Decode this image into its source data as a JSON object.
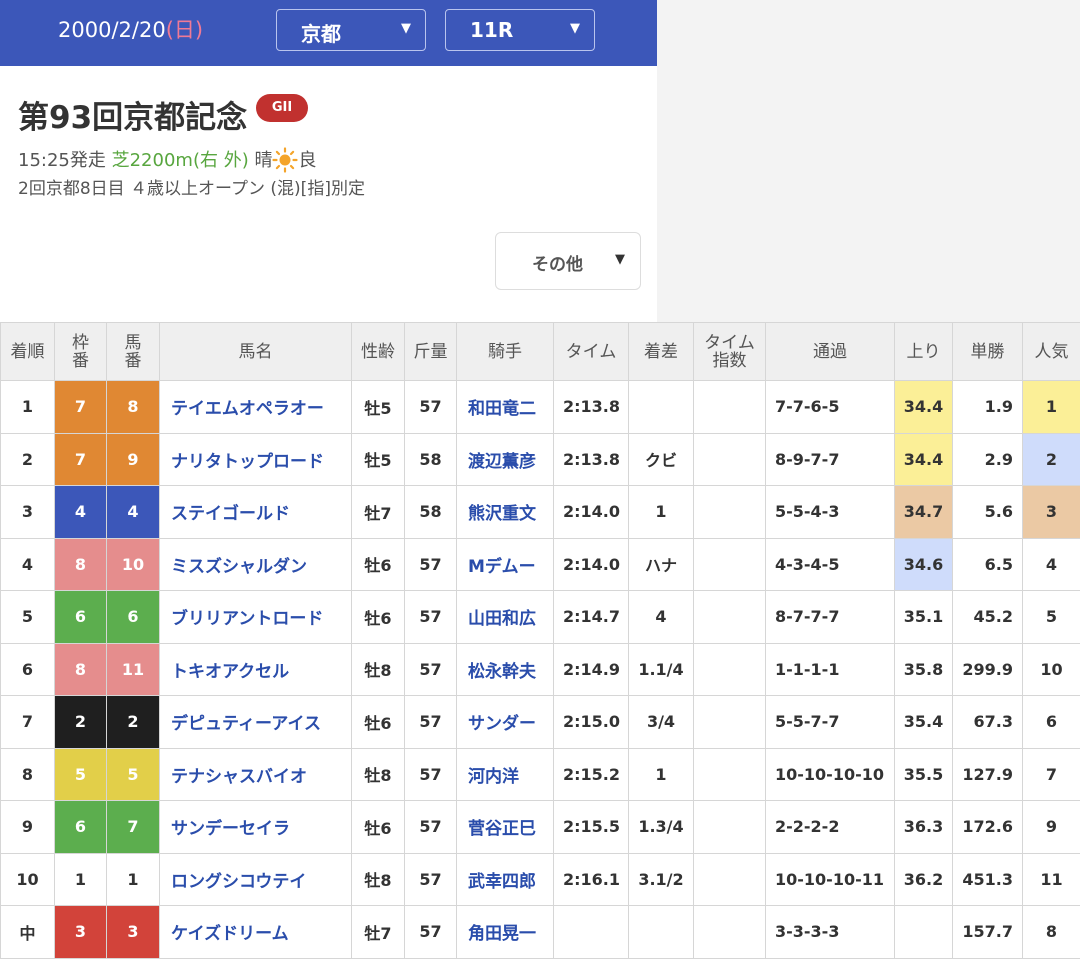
{
  "header": {
    "date": "2000/2/20",
    "day_of_week": "(日)",
    "venue_select": "京都",
    "race_select": "11R"
  },
  "race": {
    "name": "第93回京都記念",
    "grade": "GII",
    "start_time": "15:25発走",
    "course": "芝2200m(右 外)",
    "weather": "晴",
    "track_condition": "良",
    "details": "2回京都8日目 ４歳以上オープン (混)[指]別定",
    "other_menu_label": "その他"
  },
  "table": {
    "headers": {
      "rank": "着順",
      "waku_top": "枠",
      "waku_bottom": "番",
      "uma_top": "馬",
      "uma_bottom": "番",
      "horse": "馬名",
      "sex_age": "性齢",
      "weight": "斤量",
      "jockey": "騎手",
      "time": "タイム",
      "margin": "着差",
      "index_top": "タイム",
      "index_bottom": "指数",
      "passing": "通過",
      "last3f": "上り",
      "odds": "単勝",
      "popularity": "人気"
    },
    "rows": [
      {
        "rank": "1",
        "waku": "7",
        "num": "8",
        "horse": "テイエムオペラオー",
        "sex_age": "牡5",
        "weight": "57",
        "jockey": "和田竜二",
        "time": "2:13.8",
        "margin": "",
        "index": "",
        "passing": "7-7-6-5",
        "last3f": "34.4",
        "odds": "1.9",
        "pop": "1"
      },
      {
        "rank": "2",
        "waku": "7",
        "num": "9",
        "horse": "ナリタトップロード",
        "sex_age": "牡5",
        "weight": "58",
        "jockey": "渡辺薫彦",
        "time": "2:13.8",
        "margin": "クビ",
        "index": "",
        "passing": "8-9-7-7",
        "last3f": "34.4",
        "odds": "2.9",
        "pop": "2"
      },
      {
        "rank": "3",
        "waku": "4",
        "num": "4",
        "horse": "ステイゴールド",
        "sex_age": "牡7",
        "weight": "58",
        "jockey": "熊沢重文",
        "time": "2:14.0",
        "margin": "1",
        "index": "",
        "passing": "5-5-4-3",
        "last3f": "34.7",
        "odds": "5.6",
        "pop": "3"
      },
      {
        "rank": "4",
        "waku": "8",
        "num": "10",
        "horse": "ミスズシャルダン",
        "sex_age": "牡6",
        "weight": "57",
        "jockey": "Mデムー",
        "time": "2:14.0",
        "margin": "ハナ",
        "index": "",
        "passing": "4-3-4-5",
        "last3f": "34.6",
        "odds": "6.5",
        "pop": "4"
      },
      {
        "rank": "5",
        "waku": "6",
        "num": "6",
        "horse": "ブリリアントロード",
        "sex_age": "牡6",
        "weight": "57",
        "jockey": "山田和広",
        "time": "2:14.7",
        "margin": "4",
        "index": "",
        "passing": "8-7-7-7",
        "last3f": "35.1",
        "odds": "45.2",
        "pop": "5"
      },
      {
        "rank": "6",
        "waku": "8",
        "num": "11",
        "horse": "トキオアクセル",
        "sex_age": "牡8",
        "weight": "57",
        "jockey": "松永幹夫",
        "time": "2:14.9",
        "margin": "1.1/4",
        "index": "",
        "passing": "1-1-1-1",
        "last3f": "35.8",
        "odds": "299.9",
        "pop": "10"
      },
      {
        "rank": "7",
        "waku": "2",
        "num": "2",
        "horse": "デピュティーアイス",
        "sex_age": "牡6",
        "weight": "57",
        "jockey": "サンダー",
        "time": "2:15.0",
        "margin": "3/4",
        "index": "",
        "passing": "5-5-7-7",
        "last3f": "35.4",
        "odds": "67.3",
        "pop": "6"
      },
      {
        "rank": "8",
        "waku": "5",
        "num": "5",
        "horse": "テナシャスバイオ",
        "sex_age": "牡8",
        "weight": "57",
        "jockey": "河内洋",
        "time": "2:15.2",
        "margin": "1",
        "index": "",
        "passing": "10-10-10-10",
        "last3f": "35.5",
        "odds": "127.9",
        "pop": "7"
      },
      {
        "rank": "9",
        "waku": "6",
        "num": "7",
        "horse": "サンデーセイラ",
        "sex_age": "牡6",
        "weight": "57",
        "jockey": "菅谷正巳",
        "time": "2:15.5",
        "margin": "1.3/4",
        "index": "",
        "passing": "2-2-2-2",
        "last3f": "36.3",
        "odds": "172.6",
        "pop": "9"
      },
      {
        "rank": "10",
        "waku": "1",
        "num": "1",
        "horse": "ロングシコウテイ",
        "sex_age": "牡8",
        "weight": "57",
        "jockey": "武幸四郎",
        "time": "2:16.1",
        "margin": "3.1/2",
        "index": "",
        "passing": "10-10-10-11",
        "last3f": "36.2",
        "odds": "451.3",
        "pop": "11"
      },
      {
        "rank": "中",
        "waku": "3",
        "num": "3",
        "horse": "ケイズドリーム",
        "sex_age": "牡7",
        "weight": "57",
        "jockey": "角田晃一",
        "time": "",
        "margin": "",
        "index": "",
        "passing": "3-3-3-3",
        "last3f": "",
        "odds": "157.7",
        "pop": "8"
      }
    ],
    "last3f_highlight": [
      "gold",
      "gold",
      "bronze",
      "silver",
      "",
      "",
      "",
      "",
      "",
      "",
      ""
    ],
    "pop_highlight": [
      "gold",
      "silver",
      "bronze",
      "",
      "",
      "",
      "",
      "",
      "",
      "",
      ""
    ]
  },
  "colors": {
    "header_bg": "#3c57b9",
    "link_blue": "#2a4dab",
    "grade_red": "#c1312f",
    "course_green": "#58a63f",
    "gold": "#fbef97",
    "silver": "#cfdcfb",
    "bronze": "#ebc9a4"
  }
}
